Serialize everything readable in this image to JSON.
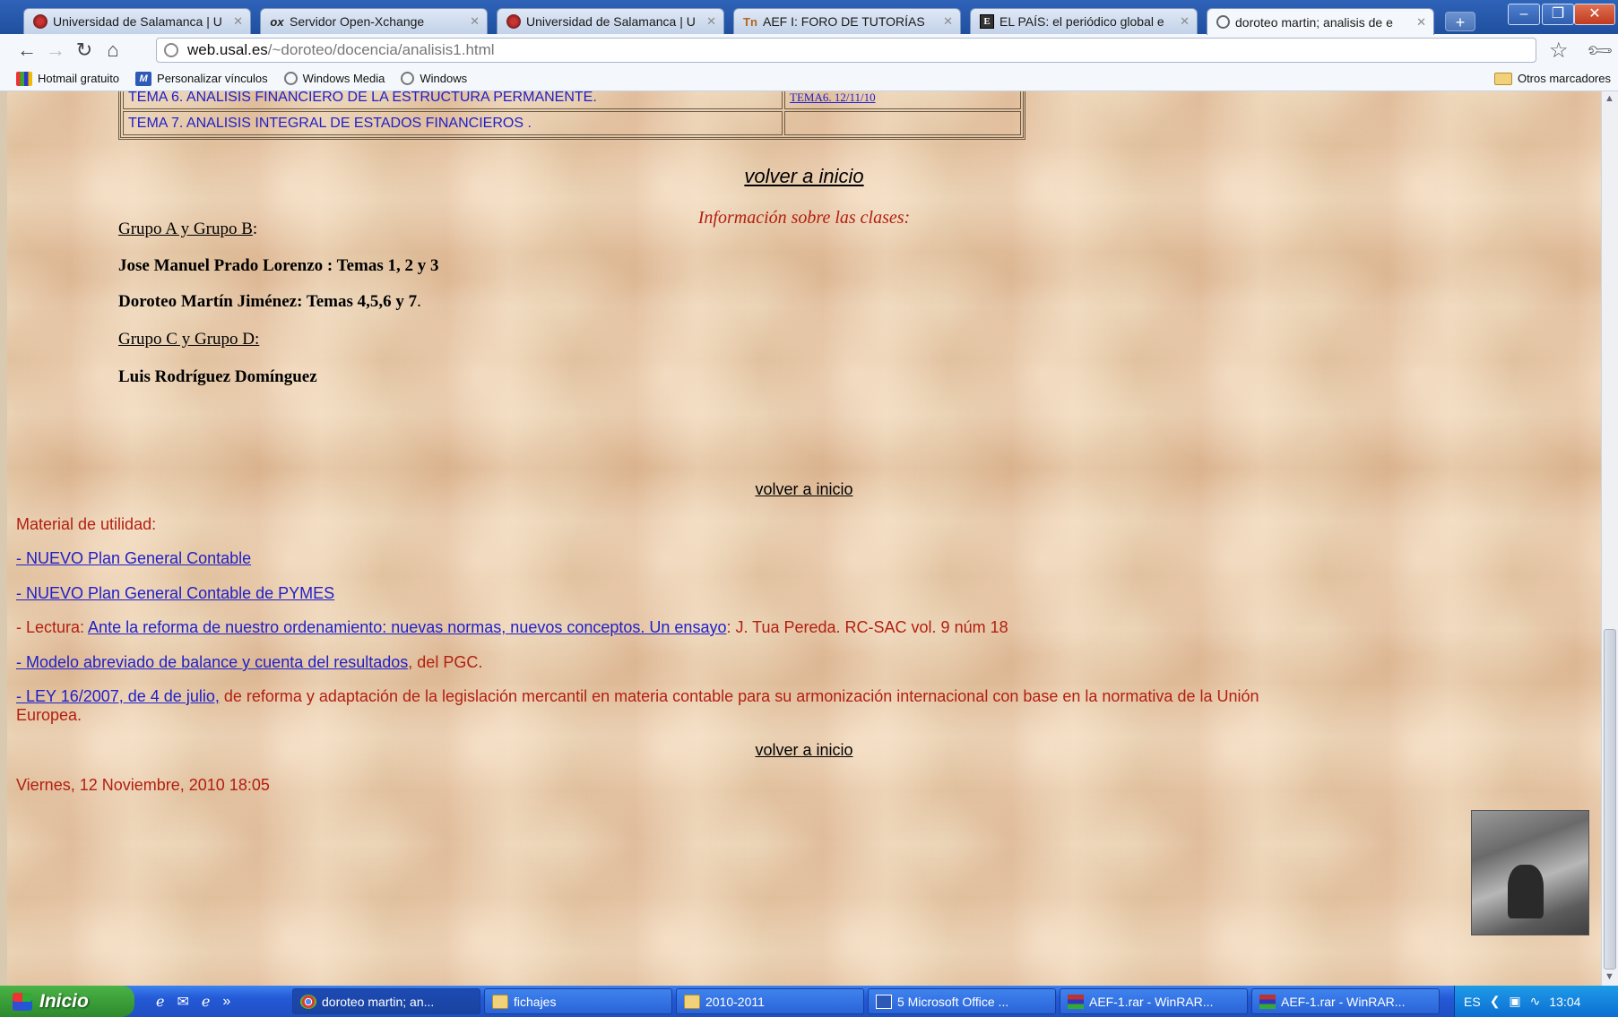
{
  "browser": {
    "tabs": [
      {
        "title": "Universidad de Salamanca | U",
        "icon": "usal-icon"
      },
      {
        "title": "Servidor Open-Xchange",
        "icon": "ox-icon"
      },
      {
        "title": "Universidad de Salamanca | U",
        "icon": "usal-icon"
      },
      {
        "title": "AEF I: FORO DE TUTORÍAS",
        "icon": "tn-icon"
      },
      {
        "title": "EL PAÍS: el periódico global e",
        "icon": "elpais-icon"
      },
      {
        "title": "doroteo martin; analisis de e",
        "icon": "globe-icon",
        "active": true
      }
    ],
    "url_host": "web.usal.es",
    "url_path": "/~doroteo/docencia/analisis1.html",
    "bookmarks": [
      "Hotmail gratuito",
      "Personalizar vínculos",
      "Windows Media",
      "Windows"
    ],
    "other_bookmarks": "Otros marcadores"
  },
  "page": {
    "table_rows": [
      {
        "tema": "TEMA 6. ANALISIS FINANCIERO DE LA ESTRUCTURA PERMANENTE.",
        "link": "TEMA6. 12/11/10"
      },
      {
        "tema": "TEMA 7. ANALISIS INTEGRAL DE ESTADOS FINANCIEROS .",
        "link": ""
      }
    ],
    "volver_1": "volver a inicio",
    "info_title": "Información sobre las clases:",
    "grupo_ab": "Grupo A y Grupo B",
    "grupo_ab_suffix": ":",
    "prof_1": "Jose Manuel Prado Lorenzo : Temas 1, 2 y 3",
    "prof_2_bold": "Doroteo Martín Jiménez: Temas 4,5,6 y 7",
    "prof_2_tail": ".",
    "grupo_cd": "Grupo C y Grupo D:",
    "prof_3": "Luis Rodríguez Domínguez",
    "volver_2": "volver a inicio",
    "material_title": "Material de utilidad:",
    "link_pgc": "- NUEVO Plan General Contable",
    "link_pymes": "- NUEVO Plan General Contable de PYMES",
    "lectura_prefix": "- Lectura: ",
    "lectura_link": "Ante la reforma de nuestro ordenamiento: nuevas normas, nuevos conceptos. Un ensayo",
    "lectura_suffix": ": J. Tua Pereda. RC-SAC vol. 9 núm 18",
    "modelo_link": "- Modelo abreviado de balance y cuenta del resultados",
    "modelo_suffix": ", del PGC.",
    "ley_link": "- LEY 16/2007, de 4 de julio,",
    "ley_text_1": " de reforma y adaptación de la legislación mercantil en materia contable para su armonización internacional con base en la normativa de la Unión",
    "ley_text_2": "Europea.",
    "volver_3": "volver a inicio",
    "date": "Viernes, 12 Noviembre, 2010 18:05"
  },
  "taskbar": {
    "start": "Inicio",
    "tasks": [
      {
        "label": "doroteo martin; an...",
        "icon": "chrome-icon",
        "active": true
      },
      {
        "label": "fichajes",
        "icon": "folder-icon"
      },
      {
        "label": "2010-2011",
        "icon": "folder-icon"
      },
      {
        "label": "5 Microsoft Office ...",
        "icon": "word-icon"
      },
      {
        "label": "AEF-1.rar - WinRAR...",
        "icon": "winrar-icon"
      },
      {
        "label": "AEF-1.rar - WinRAR...",
        "icon": "winrar-icon"
      }
    ],
    "lang": "ES",
    "clock": "13:04"
  }
}
